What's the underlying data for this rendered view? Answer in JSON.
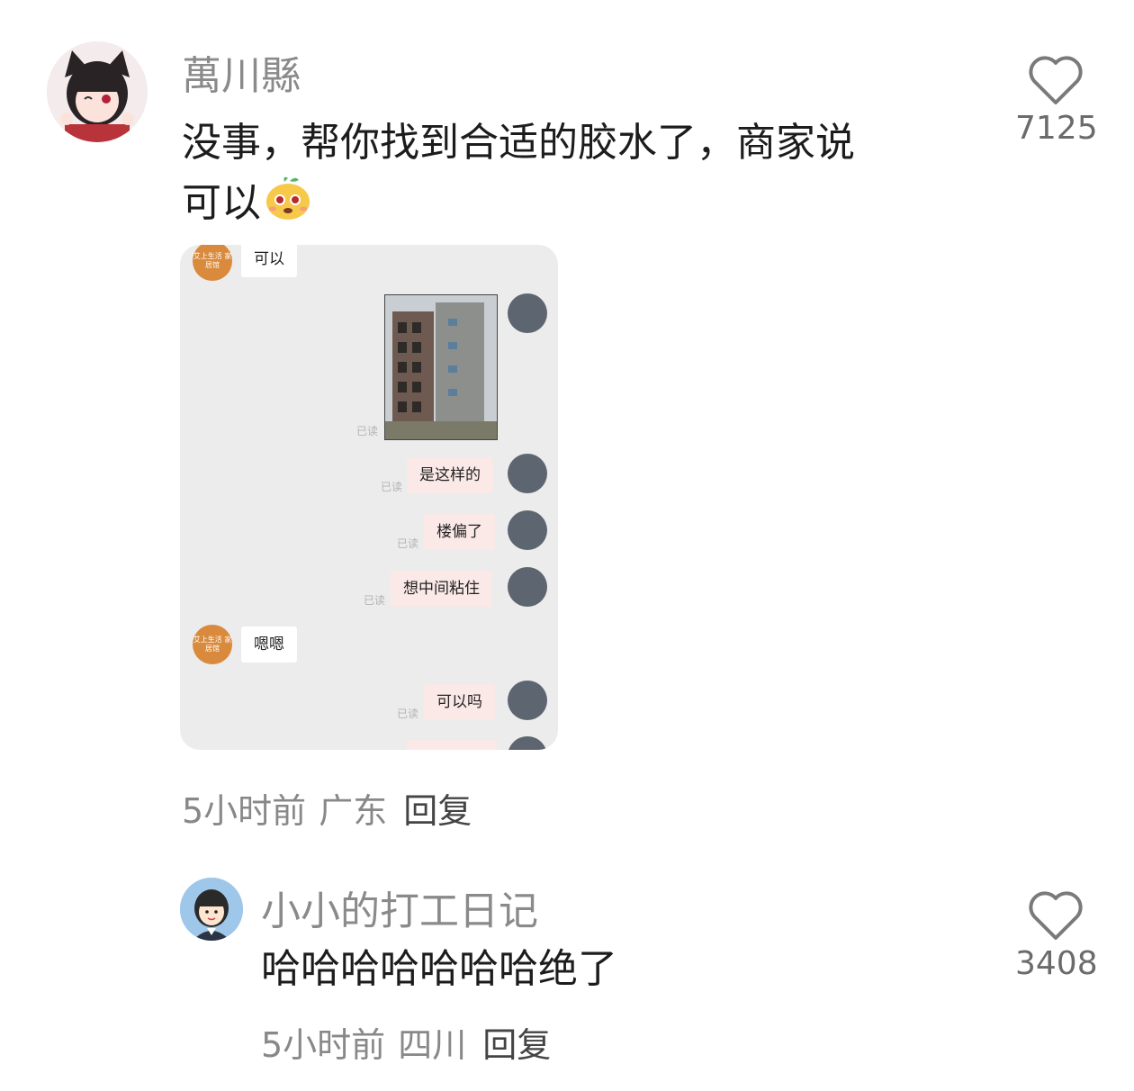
{
  "comments": [
    {
      "username": "萬川縣",
      "text_line1": "没事，帮你找到合适的胶水了，商家说",
      "text_line2": "可以",
      "time": "5小时前",
      "location": "广东",
      "reply_label": "回复",
      "likes": "7125"
    },
    {
      "username": "小小的打工日记",
      "text": "哈哈哈哈哈哈哈绝了",
      "time": "5小时前",
      "location": "四川",
      "reply_label": "回复",
      "likes": "3408"
    }
  ],
  "chat_screenshot": {
    "read_label": "已读",
    "shop_avatar_text": "艾上生活 家居馆",
    "messages": [
      {
        "side": "left",
        "text": "可以"
      },
      {
        "side": "right",
        "type": "image"
      },
      {
        "side": "right",
        "text": "是这样的"
      },
      {
        "side": "right",
        "text": "楼偏了"
      },
      {
        "side": "right",
        "text": "想中间粘住"
      },
      {
        "side": "left",
        "text": "嗯嗯"
      },
      {
        "side": "right",
        "text": "可以吗"
      }
    ]
  }
}
